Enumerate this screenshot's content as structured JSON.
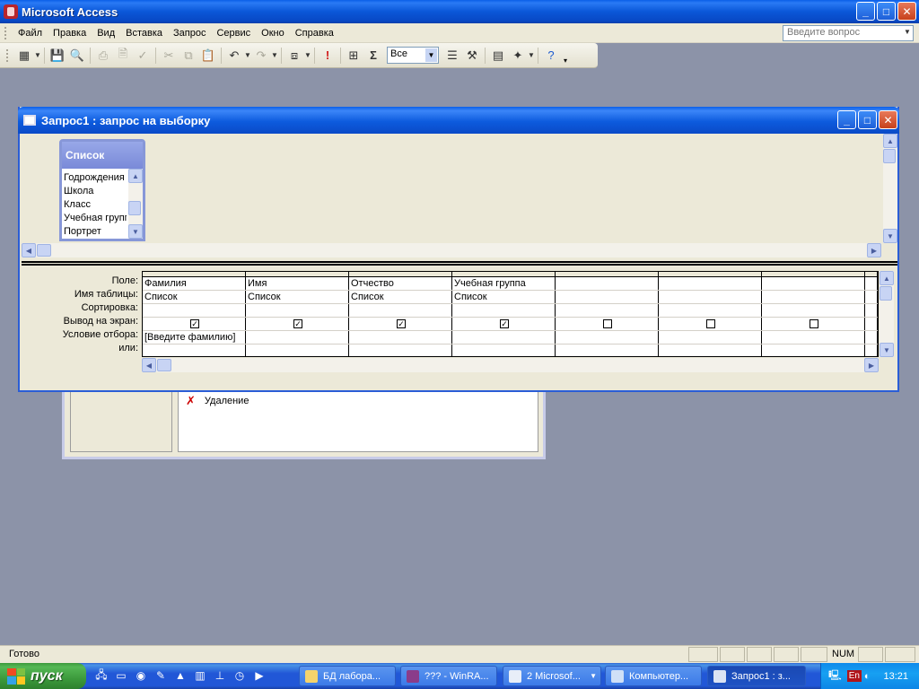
{
  "app": {
    "title": "Microsoft Access",
    "min": "_",
    "max": "□",
    "close": "✕"
  },
  "menu": {
    "items": [
      "Файл",
      "Правка",
      "Вид",
      "Вставка",
      "Запрос",
      "Сервис",
      "Окно",
      "Справка"
    ],
    "ask_placeholder": "Введите вопрос"
  },
  "toolbar": {
    "top_values": "Все"
  },
  "query_window": {
    "title": "Запрос1 : запрос на выборку",
    "table": {
      "name": "Список",
      "fields": [
        "Годрождения",
        "Школа",
        "Класс",
        "Учебная группа",
        "Портрет"
      ]
    },
    "row_labels": [
      "Поле:",
      "Имя таблицы:",
      "Сортировка:",
      "Вывод на экран:",
      "Условие отбора:",
      "или:"
    ],
    "columns": [
      {
        "field": "Фамилия",
        "table": "Список",
        "sort": "",
        "show": true,
        "criteria": "[Введите фамилию]",
        "or": ""
      },
      {
        "field": "Имя",
        "table": "Список",
        "sort": "",
        "show": true,
        "criteria": "",
        "or": ""
      },
      {
        "field": "Отчество",
        "table": "Список",
        "sort": "",
        "show": true,
        "criteria": "",
        "or": ""
      },
      {
        "field": "Учебная группа",
        "table": "Список",
        "sort": "",
        "show": true,
        "criteria": "",
        "or": ""
      },
      {
        "field": "",
        "table": "",
        "sort": "",
        "show": false,
        "criteria": "",
        "or": ""
      },
      {
        "field": "",
        "table": "",
        "sort": "",
        "show": false,
        "criteria": "",
        "or": ""
      },
      {
        "field": "",
        "table": "",
        "sort": "",
        "show": false,
        "criteria": "",
        "or": ""
      }
    ]
  },
  "background_window": {
    "item_label": "Удаление"
  },
  "statusbar": {
    "text": "Готово",
    "num": "NUM"
  },
  "taskbar": {
    "start": "пуск",
    "tasks": [
      "БД лабора...",
      "??? - WinRA...",
      "2 Microsof...",
      "Компьютер...",
      "Запрос1 : з..."
    ],
    "lang": "En",
    "time": "13:21"
  }
}
